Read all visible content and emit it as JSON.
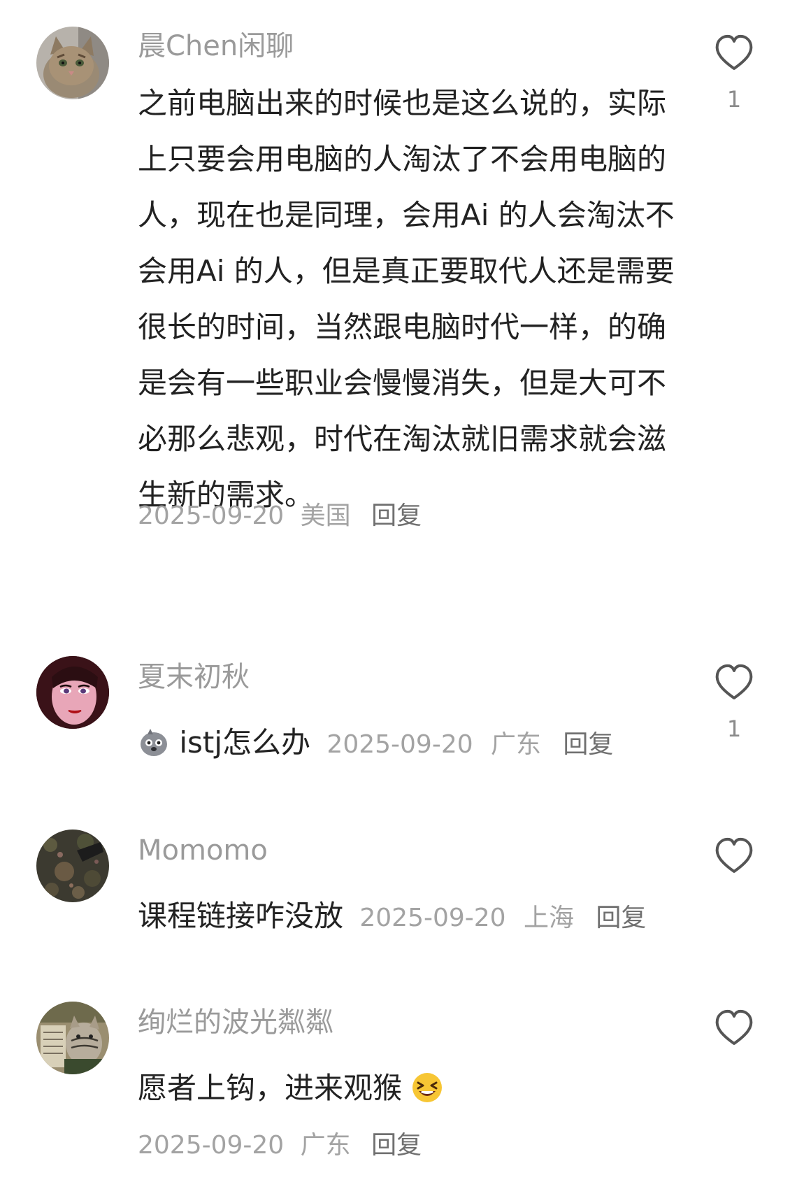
{
  "comments": [
    {
      "username": "晨Chen闲聊",
      "text": "之前电脑出来的时候也是这么说的，实际上只要会用电脑的人淘汰了不会用电脑的人，现在也是同理，会用Ai 的人会淘汰不会用Ai 的人，但是真正要取代人还是需要很长的时间，当然跟电脑时代一样，的确是会有一些职业会慢慢消失，但是大可不必那么悲观，时代在淘汰就旧需求就会滋生新的需求。",
      "date": "2025-09-20",
      "location": "美国",
      "reply_label": "回复",
      "likes": "1",
      "avatar_icon": "cat-avatar-icon"
    },
    {
      "username": "夏末初秋",
      "text": "istj怎么办",
      "emoji_icon": "pigeon-emoji-icon",
      "date": "2025-09-20",
      "location": "广东",
      "reply_label": "回复",
      "likes": "1",
      "avatar_icon": "cartoon-woman-avatar-icon"
    },
    {
      "username": "Momomo",
      "text": "课程链接咋没放",
      "date": "2025-09-20",
      "location": "上海",
      "reply_label": "回复",
      "likes": "",
      "avatar_icon": "dark-photo-avatar-icon"
    },
    {
      "username": "绚烂的波光粼粼",
      "text": "愿者上钩，进来观猴",
      "emoji_icon": "laughing-emoji-icon",
      "date": "2025-09-20",
      "location": "广东",
      "reply_label": "回复",
      "likes": "",
      "avatar_icon": "cat-newspaper-avatar-icon"
    }
  ],
  "colors": {
    "text": "#222222",
    "username": "#9a9a9a",
    "meta": "#a3a3a3",
    "reply": "#707070",
    "heart_stroke": "#555555"
  }
}
